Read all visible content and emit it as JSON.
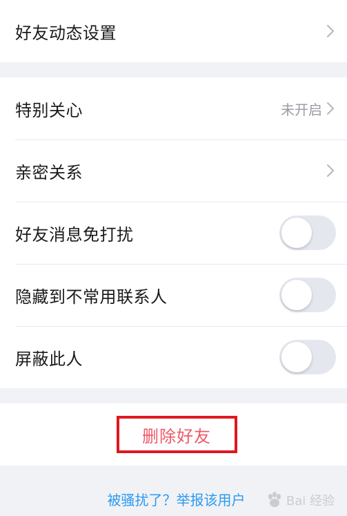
{
  "settings_top": {
    "friend_feed_label": "好友动态设置"
  },
  "settings_main": {
    "special_care_label": "特别关心",
    "special_care_value": "未开启",
    "intimacy_label": "亲密关系",
    "mute_label": "好友消息免打扰",
    "mute_on": false,
    "hide_label": "隐藏到不常用联系人",
    "hide_on": false,
    "block_label": "屏蔽此人",
    "block_on": false
  },
  "actions": {
    "delete_label": "删除好友",
    "report_label": "被骚扰了？举报该用户"
  },
  "watermark": {
    "text": "Bai 经验"
  },
  "colors": {
    "delete_text": "#f0586a",
    "highlight_border": "#e0171f",
    "link": "#2a9af0",
    "toggle_off": "#e5e7ef"
  }
}
